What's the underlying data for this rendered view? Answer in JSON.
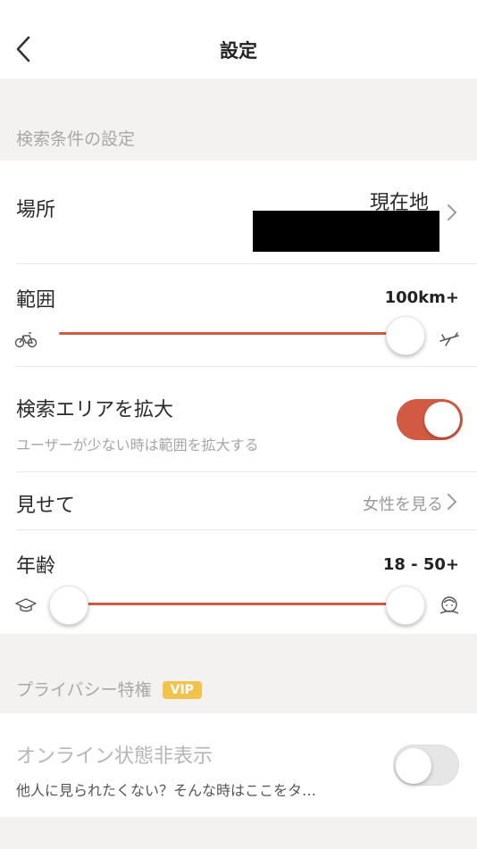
{
  "header": {
    "title": "設定",
    "back_icon": "chevron-left-icon"
  },
  "search": {
    "section_title": "検索条件の設定",
    "location": {
      "label": "場所",
      "value": "現在地"
    },
    "range": {
      "label": "範囲",
      "value": "100km+",
      "slider_fraction": 1.0,
      "start_icon": "bicycle-icon",
      "end_icon": "airplane-icon"
    },
    "expand": {
      "label": "検索エリアを拡大",
      "description": "ユーザーが少ない時は範囲を拡大する",
      "enabled": true
    },
    "show": {
      "label": "見せて",
      "value": "女性を見る"
    },
    "age": {
      "label": "年齢",
      "value": "18 - 50+",
      "min": 18,
      "max": "50+",
      "start_icon": "graduation-cap-icon",
      "end_icon": "elderly-face-icon"
    }
  },
  "privacy": {
    "section_title": "プライバシー特権",
    "badge": "VIP",
    "online_hidden": {
      "label": "オンライン状態非表示",
      "description": "他人に見られたくない？そんな時はここをタ…",
      "enabled": false
    }
  },
  "colors": {
    "accent": "#d25a42",
    "vip": "#f2c24f",
    "toggle_off": "#e6e6e6"
  }
}
